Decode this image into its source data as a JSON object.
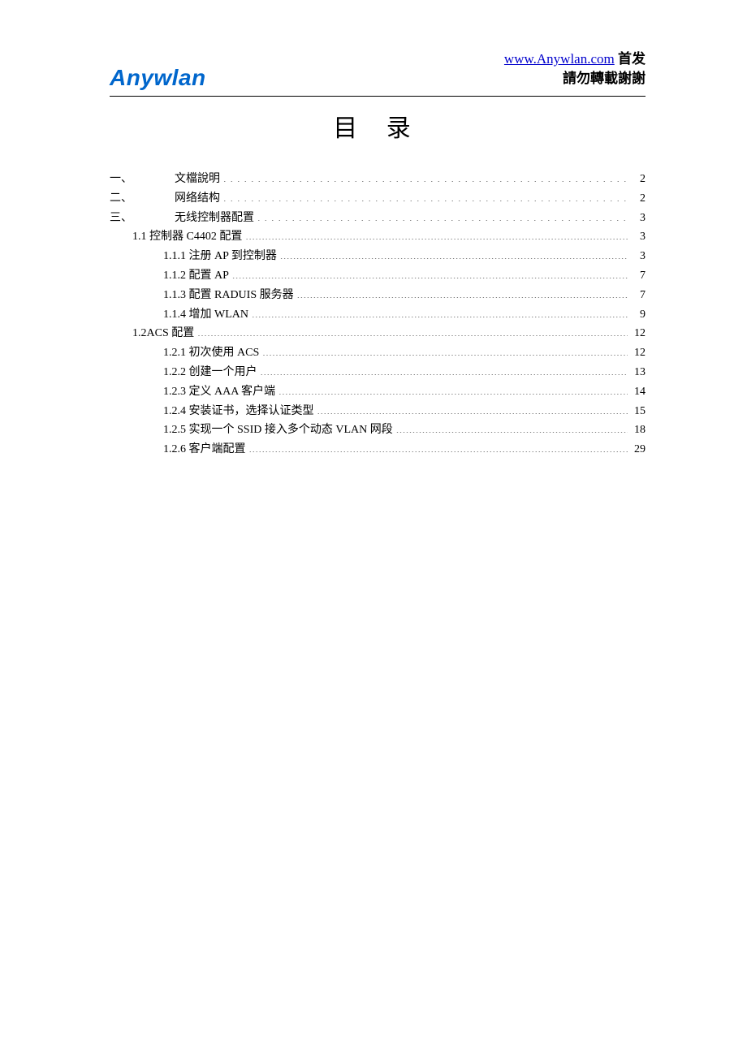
{
  "header": {
    "logo": "Anywlan",
    "url": "www.Anywlan.com",
    "suffix": "首发",
    "notice": "請勿轉載謝謝"
  },
  "title": "目 录",
  "toc": {
    "items": [
      {
        "level": 0,
        "num": "一、",
        "label": "文檔說明",
        "page": "2",
        "style": "wide"
      },
      {
        "level": 0,
        "num": "二、",
        "label": "网络结构",
        "page": "2",
        "style": "wide"
      },
      {
        "level": 0,
        "num": "三、",
        "label": "无线控制器配置",
        "page": "3",
        "style": "wide"
      },
      {
        "level": 1,
        "num": "",
        "label": "1.1 控制器 C4402 配置",
        "page": "3",
        "style": "narrow"
      },
      {
        "level": 2,
        "num": "",
        "label": "1.1.1 注册 AP 到控制器",
        "page": "3",
        "style": "narrow"
      },
      {
        "level": 2,
        "num": "",
        "label": "1.1.2 配置 AP",
        "page": "7",
        "style": "narrow"
      },
      {
        "level": 2,
        "num": "",
        "label": "1.1.3  配置 RADUIS 服务器",
        "page": "7",
        "style": "narrow"
      },
      {
        "level": 2,
        "num": "",
        "label": "1.1.4 增加 WLAN",
        "page": "9",
        "style": "narrow"
      },
      {
        "level": 1,
        "num": "",
        "label": "1.2ACS 配置",
        "page": "12",
        "style": "narrow"
      },
      {
        "level": 2,
        "num": "",
        "label": "1.2.1 初次使用 ACS",
        "page": "12",
        "style": "narrow"
      },
      {
        "level": 2,
        "num": "",
        "label": "1.2.2 创建一个用户",
        "page": "13",
        "style": "narrow"
      },
      {
        "level": 2,
        "num": "",
        "label": "1.2.3 定义 AAA 客户端",
        "page": "14",
        "style": "narrow"
      },
      {
        "level": 2,
        "num": "",
        "label": "1.2.4 安装证书，选择认证类型",
        "page": "15",
        "style": "narrow"
      },
      {
        "level": 2,
        "num": "",
        "label": "1.2.5 实现一个 SSID 接入多个动态 VLAN 网段",
        "page": "18",
        "style": "narrow"
      },
      {
        "level": 2,
        "num": "",
        "label": "1.2.6 客户端配置",
        "page": "29",
        "style": "narrow"
      }
    ]
  }
}
